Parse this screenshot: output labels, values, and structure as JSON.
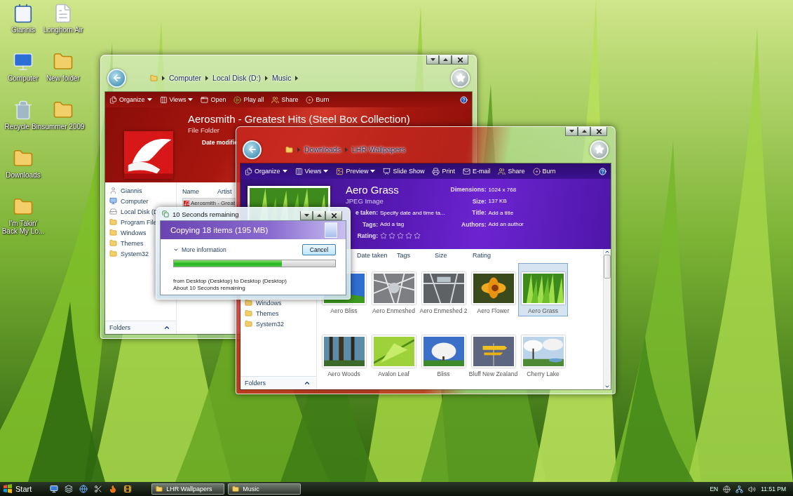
{
  "desktop": {
    "icon_columns": [
      {
        "icons": [
          {
            "label": "Giannis",
            "kind": "contact"
          },
          {
            "label": "Computer",
            "kind": "computer"
          },
          {
            "label": "Recycle Bin",
            "kind": "recycle"
          },
          {
            "label": "Downloads",
            "kind": "folder"
          },
          {
            "label": "I'm Takin' Back My Lo...",
            "kind": "folder"
          }
        ]
      },
      {
        "icons": [
          {
            "label": "Longhorn Air",
            "kind": "document"
          },
          {
            "label": "New folder",
            "kind": "folder"
          },
          {
            "label": "summer 2009",
            "kind": "folder"
          }
        ]
      }
    ]
  },
  "music_window": {
    "breadcrumb": [
      "Computer",
      "Local Disk (D:)",
      "Music"
    ],
    "toolbar": [
      {
        "label": "Organize",
        "kind": "organize",
        "dropdown": true
      },
      {
        "label": "Views",
        "kind": "views",
        "dropdown": true
      },
      {
        "label": "Open",
        "kind": "open",
        "dropdown": false
      },
      {
        "label": "Play all",
        "kind": "play",
        "dropdown": false
      },
      {
        "label": "Share",
        "kind": "share",
        "dropdown": false
      },
      {
        "label": "Burn",
        "kind": "burn",
        "dropdown": false
      }
    ],
    "title": "Aerosmith - Greatest Hits (Steel Box Collection)",
    "subtitle": "File Folder",
    "detail_label": "Date modifie",
    "nav_items": [
      {
        "label": "Giannis",
        "kind": "user"
      },
      {
        "label": "Computer",
        "kind": "computer"
      },
      {
        "label": "Local Disk (D)",
        "kind": "drive"
      },
      {
        "label": "Program Files",
        "kind": "folder"
      },
      {
        "label": "Windows",
        "kind": "folder"
      },
      {
        "label": "Themes",
        "kind": "folder"
      },
      {
        "label": "System32",
        "kind": "folder"
      }
    ],
    "nav_footer": "Folders",
    "columns": [
      "Name",
      "Artist"
    ],
    "files": [
      {
        "name": "Aerosmith - Great",
        "selected": true
      }
    ]
  },
  "wallpapers_window": {
    "breadcrumb": [
      "Downloads",
      "LHR Wallpapers"
    ],
    "toolbar": [
      {
        "label": "Organize",
        "kind": "organize",
        "dropdown": true
      },
      {
        "label": "Views",
        "kind": "views",
        "dropdown": true
      },
      {
        "label": "Preview",
        "kind": "preview",
        "dropdown": true
      },
      {
        "label": "Slide Show",
        "kind": "slideshow",
        "dropdown": false
      },
      {
        "label": "Print",
        "kind": "print",
        "dropdown": false
      },
      {
        "label": "E-mail",
        "kind": "email",
        "dropdown": false
      },
      {
        "label": "Share",
        "kind": "share",
        "dropdown": false
      },
      {
        "label": "Burn",
        "kind": "burn",
        "dropdown": false
      }
    ],
    "title": "Aero Grass",
    "subtitle": "JPEG Image",
    "details_left": [
      {
        "label": "e taken:",
        "value": "Specify date and time ta..."
      },
      {
        "label": "Tags:",
        "value": "Add a tag"
      }
    ],
    "rating": {
      "label": "Rating:",
      "stars": 0
    },
    "details_right": [
      {
        "label": "Dimensions:",
        "value": "1024 x 768"
      },
      {
        "label": "Size:",
        "value": "137 KB"
      },
      {
        "label": "Title:",
        "value": "Add a title"
      },
      {
        "label": "Authors:",
        "value": "Add an author"
      }
    ],
    "nav_items": [
      {
        "label": "Windows",
        "kind": "folder"
      },
      {
        "label": "Themes",
        "kind": "folder"
      },
      {
        "label": "System32",
        "kind": "folder"
      }
    ],
    "nav_footer": "Folders",
    "columns": [
      "Date taken",
      "Tags",
      "Size",
      "Rating"
    ],
    "items": [
      {
        "name": "Aero Bliss",
        "selected": false
      },
      {
        "name": "Aero Enmeshed",
        "selected": false
      },
      {
        "name": "Aero Enmeshed 2",
        "selected": false
      },
      {
        "name": "Aero Flower",
        "selected": false
      },
      {
        "name": "Aero Grass",
        "selected": true
      },
      {
        "name": "Aero Woods",
        "selected": false
      },
      {
        "name": "Avalon Leaf",
        "selected": false
      },
      {
        "name": "Bliss",
        "selected": false
      },
      {
        "name": "Bluff New Zealand",
        "selected": false
      },
      {
        "name": "Cherry Lake",
        "selected": false
      }
    ]
  },
  "copy_dialog": {
    "title": "10 Seconds remaining",
    "heading": "Copying 18 items (195 MB)",
    "details_toggle": "More information",
    "cancel": "Cancel",
    "progress": {
      "level": 0.67
    },
    "lines": [
      "from Desktop (Desktop) to Desktop (Desktop)",
      "About 10 Seconds remaining"
    ]
  },
  "taskbar": {
    "start": "Start",
    "tasks": [
      "LHR Wallpapers",
      "Music"
    ],
    "language": "EN",
    "clock": "11:51 PM"
  }
}
